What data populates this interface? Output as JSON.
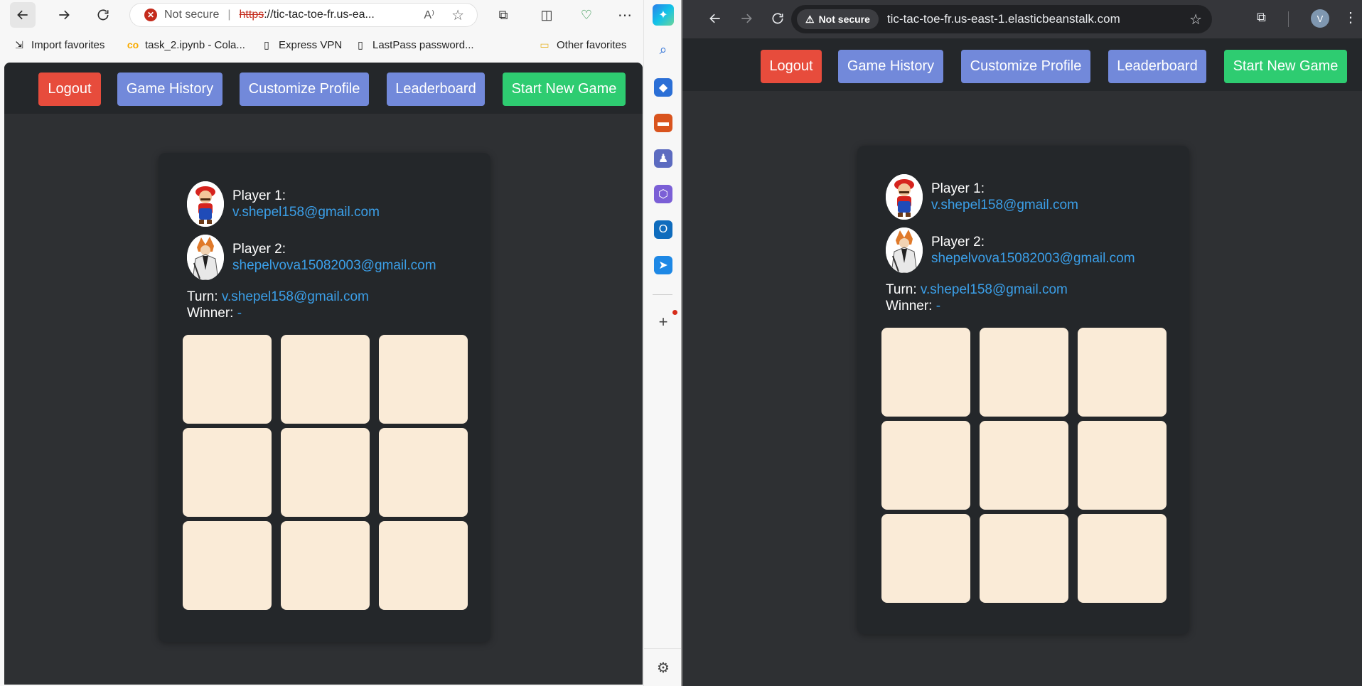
{
  "edge": {
    "address": {
      "security_label": "Not secure",
      "scheme": "https",
      "host_truncated": "://tic-tac-toe-fr.us-ea..."
    },
    "bookmarks": [
      {
        "label": "Import favorites"
      },
      {
        "label": "task_2.ipynb - Cola..."
      },
      {
        "label": "Express VPN"
      },
      {
        "label": "LastPass password..."
      },
      {
        "label": "Other favorites"
      }
    ]
  },
  "chrome": {
    "address": {
      "security_label": "Not secure",
      "host": "tic-tac-toe-fr.us-east-1.elasticbeanstalk.com"
    },
    "profile_initial": "V"
  },
  "app": {
    "nav": {
      "logout": "Logout",
      "game_history": "Game History",
      "customize_profile": "Customize Profile",
      "leaderboard": "Leaderboard",
      "start_new_game": "Start New Game"
    },
    "players": [
      {
        "label": "Player 1:",
        "email": "v.shepel158@gmail.com",
        "avatar": "mario-avatar"
      },
      {
        "label": "Player 2:",
        "email": "shepelvova15082003@gmail.com",
        "avatar": "anime-character-avatar"
      }
    ],
    "turn": {
      "label": "Turn:",
      "value": "v.shepel158@gmail.com"
    },
    "winner": {
      "label": "Winner:",
      "value": "-"
    },
    "board": [
      "",
      "",
      "",
      "",
      "",
      "",
      "",
      "",
      ""
    ],
    "colors": {
      "logout": "#e74c3c",
      "nav_button": "#7289da",
      "new_game": "#2ecc71",
      "cell": "#faebd7",
      "link": "#3b9fe8",
      "background": "#2e3033",
      "card": "#24272a"
    }
  }
}
